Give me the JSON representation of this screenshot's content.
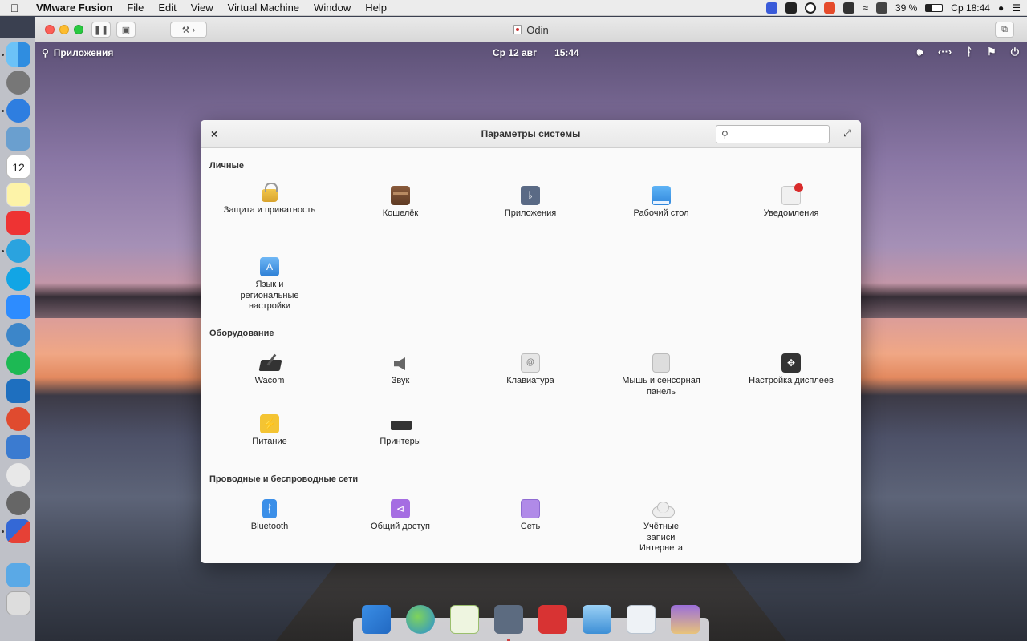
{
  "mac_menubar": {
    "app_name": "VMware Fusion",
    "menus": [
      "File",
      "Edit",
      "View",
      "Virtual Machine",
      "Window",
      "Help"
    ],
    "battery": "39 %",
    "clock": "Ср 18:44"
  },
  "vm_window": {
    "title": "Odin"
  },
  "guest_panel": {
    "apps_label": "Приложения",
    "date": "Ср 12 авг",
    "time": "15:44"
  },
  "settings": {
    "title": "Параметры системы",
    "search_value": "",
    "categories": [
      {
        "title": "Личные",
        "items": [
          {
            "label": "Защита и приватность",
            "icon": "lock-icon"
          },
          {
            "label": "Кошелёк",
            "icon": "wallet-icon"
          },
          {
            "label": "Приложения",
            "icon": "applications-icon"
          },
          {
            "label": "Рабочий стол",
            "icon": "desktop-icon"
          },
          {
            "label": "Уведомления",
            "icon": "notifications-icon"
          },
          {
            "label": "Язык и региональные настройки",
            "icon": "language-icon"
          }
        ]
      },
      {
        "title": "Оборудование",
        "items": [
          {
            "label": "Wacom",
            "icon": "tablet-icon"
          },
          {
            "label": "Звук",
            "icon": "speaker-icon"
          },
          {
            "label": "Клавиатура",
            "icon": "keyboard-icon"
          },
          {
            "label": "Мышь и сенсорная панель",
            "icon": "mouse-icon"
          },
          {
            "label": "Настройка дисплеев",
            "icon": "display-icon"
          },
          {
            "label": "Питание",
            "icon": "power-icon"
          },
          {
            "label": "Принтеры",
            "icon": "printer-icon"
          }
        ]
      },
      {
        "title": "Проводные и беспроводные сети",
        "items": [
          {
            "label": "Bluetooth",
            "icon": "bluetooth-icon"
          },
          {
            "label": "Общий доступ",
            "icon": "sharing-icon"
          },
          {
            "label": "Сеть",
            "icon": "network-icon"
          },
          {
            "label": "Учётные записи Интернета",
            "icon": "cloud-icon"
          }
        ]
      }
    ]
  },
  "mac_dock": {
    "calendar_day": "12"
  }
}
